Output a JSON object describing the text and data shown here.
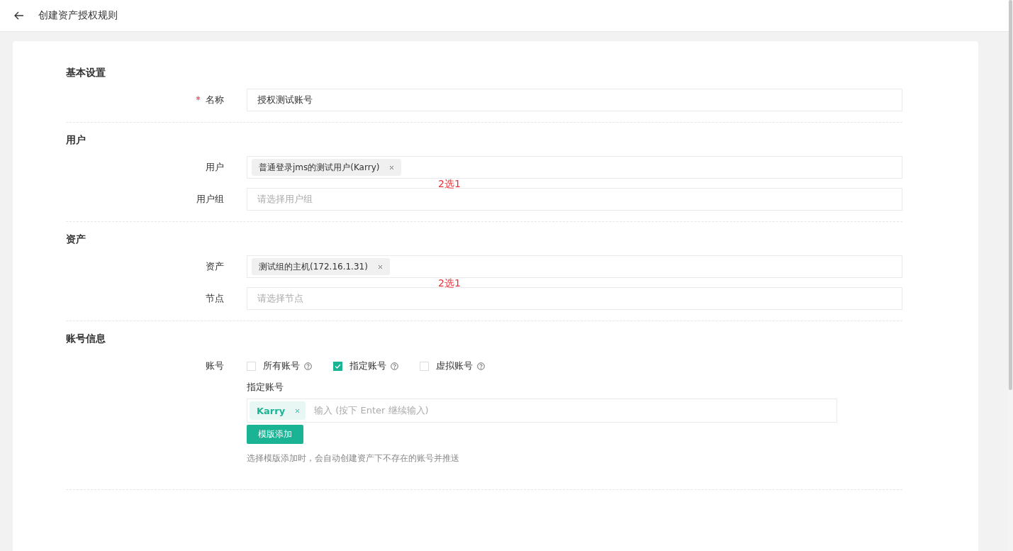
{
  "header": {
    "title": "创建资产授权规则"
  },
  "sections": [
    {
      "title": "基本设置",
      "rows": [
        {
          "kind": "text",
          "label": "名称",
          "required": true,
          "value": "授权测试账号"
        }
      ]
    },
    {
      "title": "用户",
      "annotation": "2选1",
      "rows": [
        {
          "kind": "select",
          "label": "用户",
          "tags": [
            "普通登录jms的测试用户(Karry)"
          ]
        },
        {
          "kind": "select",
          "label": "用户组",
          "placeholder": "请选择用户组"
        }
      ]
    },
    {
      "title": "资产",
      "annotation": "2选1",
      "rows": [
        {
          "kind": "select",
          "label": "资产",
          "tags": [
            "测试组的主机(172.16.1.31)"
          ]
        },
        {
          "kind": "select",
          "label": "节点",
          "placeholder": "请选择节点"
        }
      ]
    },
    {
      "title": "账号信息",
      "rows": [
        {
          "kind": "checks",
          "label": "账号",
          "options": [
            {
              "label": "所有账号",
              "checked": false
            },
            {
              "label": "指定账号",
              "checked": true
            },
            {
              "label": "虚拟账号",
              "checked": false
            }
          ],
          "sub": {
            "label": "指定账号",
            "tags": [
              "Karry"
            ],
            "placeholder": "输入 (按下 Enter 继续输入)",
            "button": "模版添加",
            "hint": "选择模版添加时，会自动创建资产下不存在的账号并推送"
          }
        }
      ]
    }
  ]
}
